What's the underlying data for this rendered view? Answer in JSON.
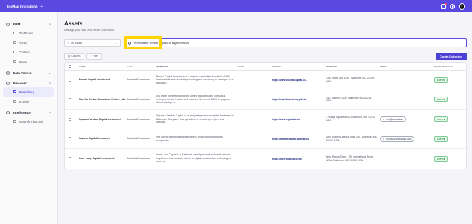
{
  "topbar": {
    "org": "EcoMap Innovations"
  },
  "sidebar": {
    "sections": [
      {
        "label": "ERM",
        "items": [
          "Dashboard",
          "Activity",
          "Contacts",
          "Cases"
        ]
      },
      {
        "label": "Data Assets",
        "items": []
      },
      {
        "label": "Discover",
        "items": [
          "Data Library",
          "Embeds"
        ]
      },
      {
        "label": "Intelligence",
        "items": [
          "Nonprofit Financial"
        ]
      }
    ]
  },
  "page": {
    "title": "Assets",
    "subtitle": "Manage your data and create collections."
  },
  "search": {
    "scope": "All Assets",
    "query": "\"% Innovative\" venture capital OR angel investors"
  },
  "toolbar": {
    "columns": "Columns",
    "filter": "Filter",
    "create": "Create Collection"
  },
  "table": {
    "headers": [
      "NAME",
      "TYPE",
      "OVERVIEW",
      "DATE",
      "WEBSITE",
      "ADDRESS",
      "EMAIL",
      "ARCHIVE STATUS"
    ],
    "rows": [
      {
        "name": "Bonsai Capital Investment",
        "type": "Financial Resources",
        "overview": "Bonsai Capital Investment is a venture capital firm founded in 1998 that specializes in seed-stage funding and mentoring for startups in the educatio...",
        "date": "",
        "website": "https://www.bonsaicapital.co...",
        "address": "1345 Smith Ave #200, Baltimore, MD 21209, USA",
        "email": "",
        "status": "ACTIVE"
      },
      {
        "name": "Novella Center: Conscious Venture Lab",
        "type": "Financial Resources",
        "overview": "A 4 month immersion program aimed at accelerating conscious entrepreneurs to traction and revenue. We invest $100K in purpose driven startups in...",
        "date": "",
        "website": "https://novellacenter.org/#cvl",
        "address": "1407 Fleet St #200, Baltimore, MD 21231, USA",
        "email": "",
        "status": "ACTIVE"
      },
      {
        "name": "Squadra Venture Capital Investment",
        "type": "Financial Resources",
        "overview": "Squadra Venture Capital is an early-stage venture capital firm based in Baltimore, Maryland, that specializes in investing in cyber and national...",
        "date": "",
        "website": "https://www.squadra.vc/",
        "address": "1 Village Square #100, Baltimore, MD 21210, USA",
        "email": "info@squadra.vc",
        "status": "ACTIVE"
      },
      {
        "name": "Savano Capital Investment",
        "type": "Financial Resources",
        "overview": "We partner with private shareholders and exceptional growth companies.",
        "date": "",
        "website": "https://savanocapital.com/about",
        "address": "2800 Quarry Lake Dr Suite 304, Baltimore, MD 21209, USA",
        "email": "info@savanocapital.com",
        "status": "ACTIVE"
      },
      {
        "name": "Inner Loop Capital Investment",
        "type": "Financial Resources",
        "overview": "Inner Loop Capital is a Baltimore-based pre-seed and seed venture capital firm that primarily invests in digital infrastructure technologies such as...",
        "date": "",
        "website": "https://innerloopcap.com/",
        "address": "Legg Mason Tower, 100 International Drive #23rd, Baltimore, MD 21202, USA",
        "email": "",
        "status": "ACTIVE"
      }
    ]
  }
}
